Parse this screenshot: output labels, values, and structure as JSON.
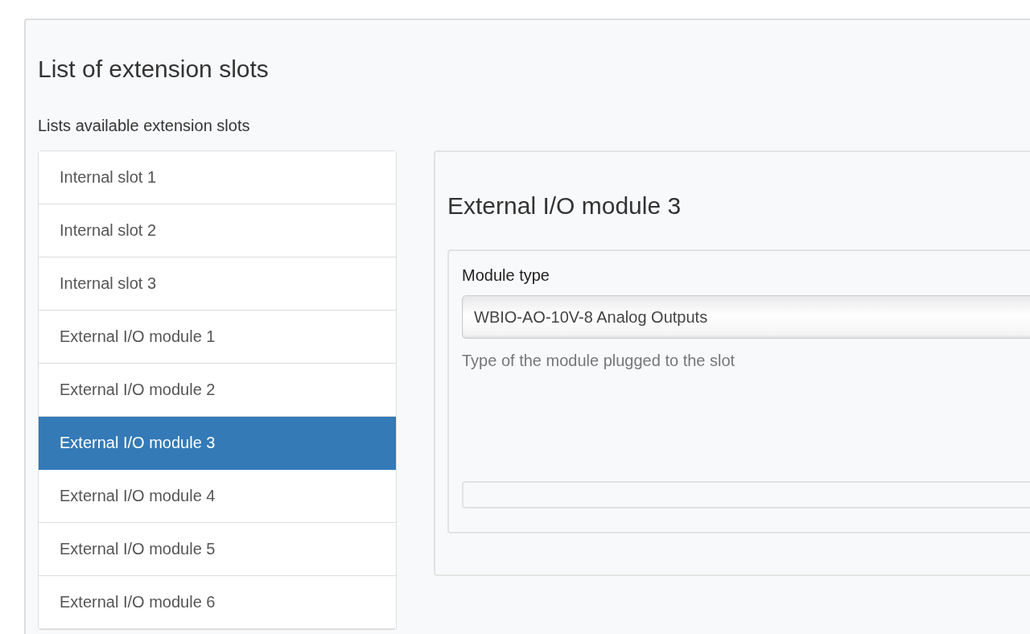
{
  "page": {
    "title": "List of extension slots",
    "description": "Lists available extension slots"
  },
  "slots": [
    {
      "label": "Internal slot 1",
      "selected": false
    },
    {
      "label": "Internal slot 2",
      "selected": false
    },
    {
      "label": "Internal slot 3",
      "selected": false
    },
    {
      "label": "External I/O module 1",
      "selected": false
    },
    {
      "label": "External I/O module 2",
      "selected": false
    },
    {
      "label": "External I/O module 3",
      "selected": true
    },
    {
      "label": "External I/O module 4",
      "selected": false
    },
    {
      "label": "External I/O module 5",
      "selected": false
    },
    {
      "label": "External I/O module 6",
      "selected": false
    }
  ],
  "detail": {
    "title": "External I/O module 3",
    "field_label": "Module type",
    "value": "WBIO-AO-10V-8 Analog Outputs",
    "help": "Type of the module plugged to the slot"
  }
}
